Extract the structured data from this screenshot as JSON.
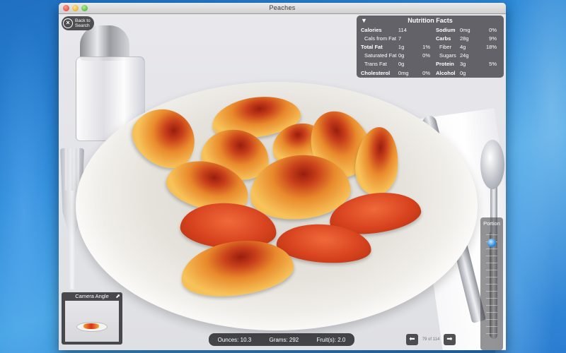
{
  "window": {
    "title": "Peaches"
  },
  "back_button": {
    "label_line1": "Back to",
    "label_line2": "Search"
  },
  "nutrition": {
    "title": "Nutrition Facts",
    "left": [
      {
        "label": "Calories",
        "amount": "114",
        "pct": ""
      },
      {
        "label": "Cals from Fat",
        "amount": "7",
        "pct": ""
      },
      {
        "label": "Total Fat",
        "amount": "1g",
        "pct": "1%"
      },
      {
        "label": "Saturated Fat",
        "amount": "0g",
        "pct": "0%"
      },
      {
        "label": "Trans Fat",
        "amount": "0g",
        "pct": ""
      },
      {
        "label": "Cholesterol",
        "amount": "0mg",
        "pct": "0%"
      }
    ],
    "right": [
      {
        "label": "Sodium",
        "amount": "0mg",
        "pct": "0%"
      },
      {
        "label": "Carbs",
        "amount": "28g",
        "pct": "9%"
      },
      {
        "label": "Fiber",
        "amount": "4g",
        "pct": "18%"
      },
      {
        "label": "Sugars",
        "amount": "24g",
        "pct": ""
      },
      {
        "label": "Protein",
        "amount": "3g",
        "pct": "5%"
      },
      {
        "label": "Alcohol",
        "amount": "0g",
        "pct": ""
      }
    ]
  },
  "camera": {
    "title": "Camera Angle"
  },
  "info": {
    "ounces": "Ounces: 10.3",
    "grams": "Grams: 292",
    "fruits": "Fruit(s): 2.0"
  },
  "pager": {
    "text": "79 of 114"
  },
  "portion": {
    "label": "Portion",
    "level": 0.93
  }
}
